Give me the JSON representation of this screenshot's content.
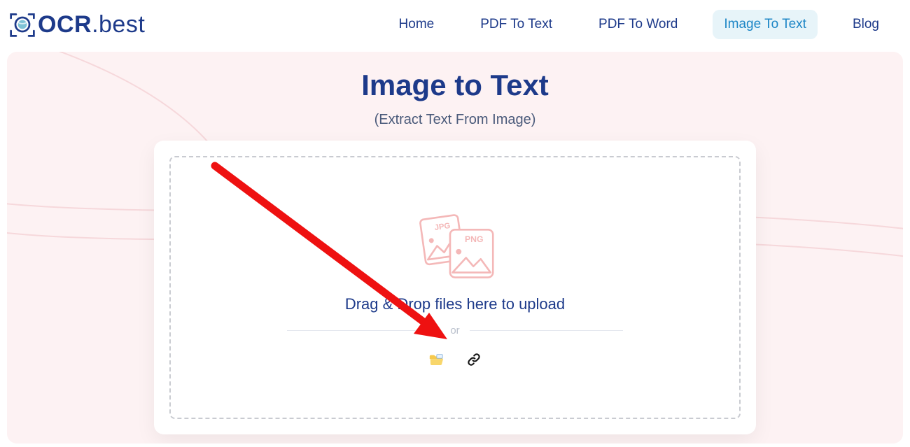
{
  "logo": {
    "brand_strong": "OCR",
    "brand_thin": ".best"
  },
  "nav": {
    "items": [
      {
        "label": "Home",
        "active": false
      },
      {
        "label": "PDF To Text",
        "active": false
      },
      {
        "label": "PDF To Word",
        "active": false
      },
      {
        "label": "Image To Text",
        "active": true
      },
      {
        "label": "Blog",
        "active": false
      }
    ]
  },
  "hero": {
    "title": "Image to Text",
    "subtitle": "(Extract Text From Image)"
  },
  "upload": {
    "illustration_labels": {
      "jpg": "JPG",
      "png": "PNG"
    },
    "drop_text": "Drag & Drop files here to upload",
    "or_label": "or"
  }
}
